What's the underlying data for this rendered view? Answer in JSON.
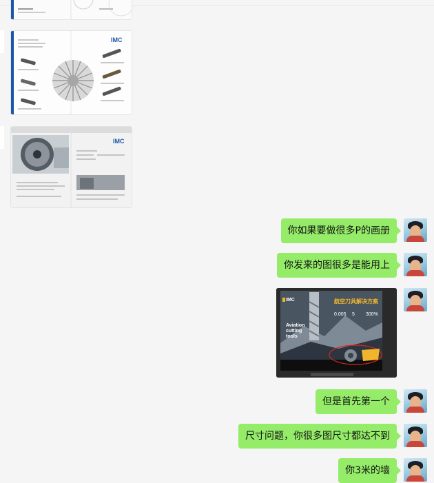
{
  "left_images": [
    {
      "alt": "brochure-page-top"
    },
    {
      "logo": "IMC"
    },
    {
      "logo": "IMC"
    }
  ],
  "messages": [
    {
      "text": "你如果要做很多P的画册"
    },
    {
      "text": "你发来的图很多是能用上"
    },
    {
      "type": "image",
      "logo": "IMC",
      "headline": "航空刀具解决方案",
      "stats": [
        "0.005",
        "5",
        "300%"
      ],
      "subtitle": [
        "Aviation",
        "cutting",
        "tools"
      ]
    },
    {
      "text": "但是首先第一个"
    },
    {
      "text": "尺寸问题，你很多图尺寸都达不到"
    },
    {
      "text": "你3米的墙"
    }
  ],
  "colors": {
    "bubble": "#95ec69",
    "background": "#f5f5f5",
    "imc_blue": "#1b57a6"
  }
}
